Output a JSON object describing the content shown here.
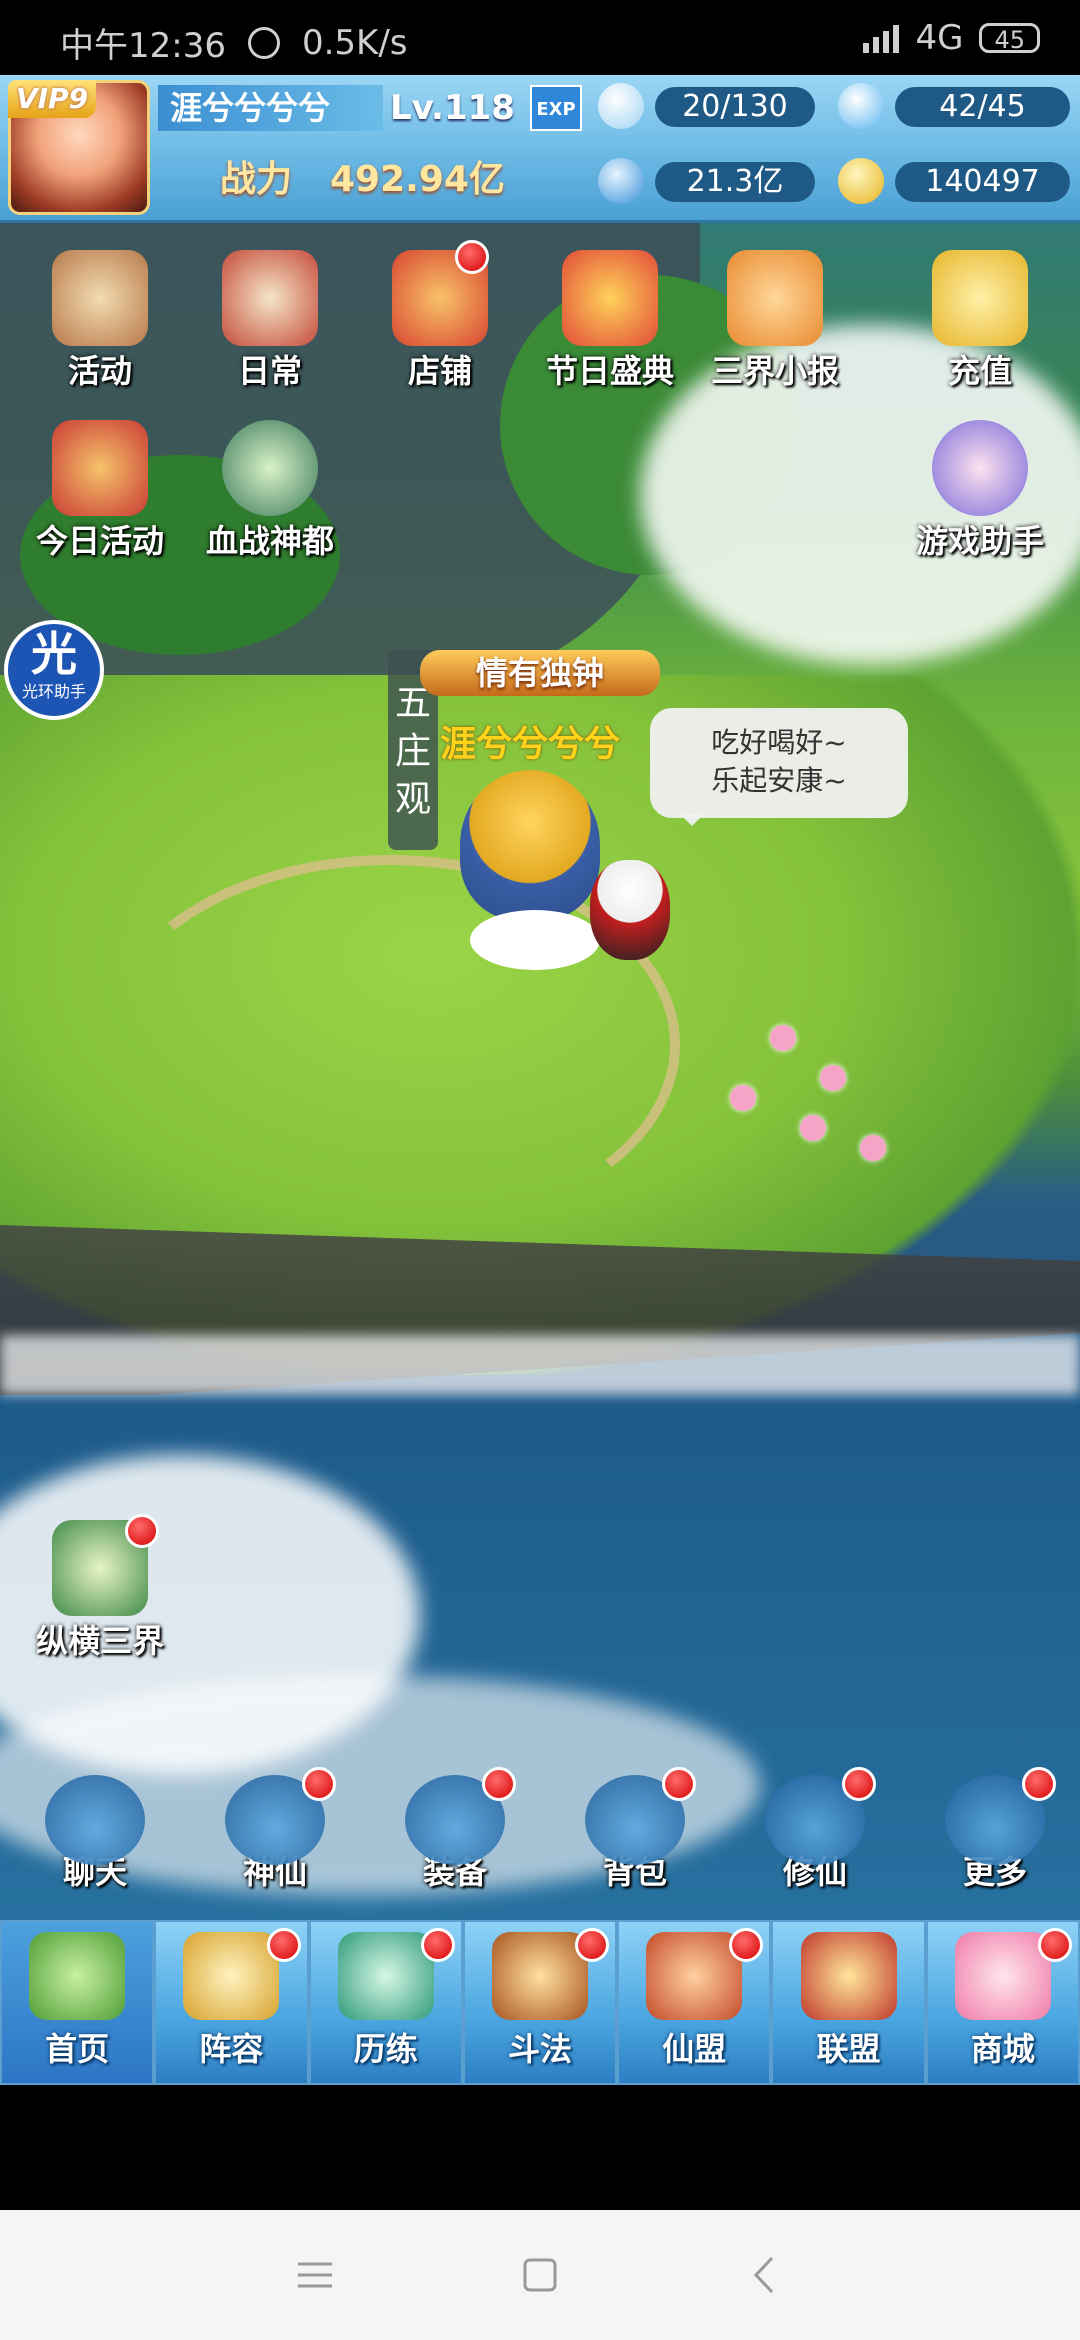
{
  "statusbar": {
    "time": "中午12:36",
    "speed": "0.5K/s",
    "network": "4G",
    "battery": "45"
  },
  "hud": {
    "vip": "VIP9",
    "player_name": "涯兮兮兮兮",
    "level": "Lv.118",
    "exp_label": "EXP",
    "power_label": "战力",
    "power_value": "492.94亿",
    "stamina": "20/130",
    "energy": "42/45",
    "silver": "21.3亿",
    "gold": "140497"
  },
  "features_row1": [
    {
      "label": "活动",
      "color": "#b8794a",
      "dot": false
    },
    {
      "label": "日常",
      "color": "#c44a3a",
      "dot": false
    },
    {
      "label": "店铺",
      "color": "#d8452f",
      "dot": true
    },
    {
      "label": "节日盛典",
      "color": "#e14b37",
      "dot": false
    },
    {
      "label": "三界小报",
      "color": "#e88a2e",
      "dot": false
    },
    {
      "label": "充值",
      "color": "#e6b52a",
      "dot": false
    }
  ],
  "features_row2": [
    {
      "label": "今日活动",
      "color": "#c93a33"
    },
    {
      "label": "血战神都",
      "color": "#3b7a5a"
    },
    {
      "label": "游戏助手",
      "color": "#7b6ad8"
    }
  ],
  "helper": {
    "big": "光",
    "small": "光环助手"
  },
  "location": {
    "name": "五庄观"
  },
  "title_banner": "情有独钟",
  "player_overhead_name": "涯兮兮兮兮",
  "speech": {
    "line1": "吃好喝好~",
    "line2": "乐起安康~"
  },
  "side_feature": {
    "label": "纵横三界"
  },
  "actions": [
    {
      "label": "聊天",
      "dot": false
    },
    {
      "label": "神仙",
      "dot": true
    },
    {
      "label": "装备",
      "dot": true
    },
    {
      "label": "背包",
      "dot": true
    },
    {
      "label": "修仙",
      "dot": true
    },
    {
      "label": "更多",
      "dot": true
    }
  ],
  "nav": [
    {
      "label": "首页",
      "active": true,
      "dot": false
    },
    {
      "label": "阵容",
      "active": false,
      "dot": true
    },
    {
      "label": "历练",
      "active": false,
      "dot": true
    },
    {
      "label": "斗法",
      "active": false,
      "dot": true
    },
    {
      "label": "仙盟",
      "active": false,
      "dot": true
    },
    {
      "label": "联盟",
      "active": false,
      "dot": false
    },
    {
      "label": "商城",
      "active": false,
      "dot": true
    }
  ]
}
